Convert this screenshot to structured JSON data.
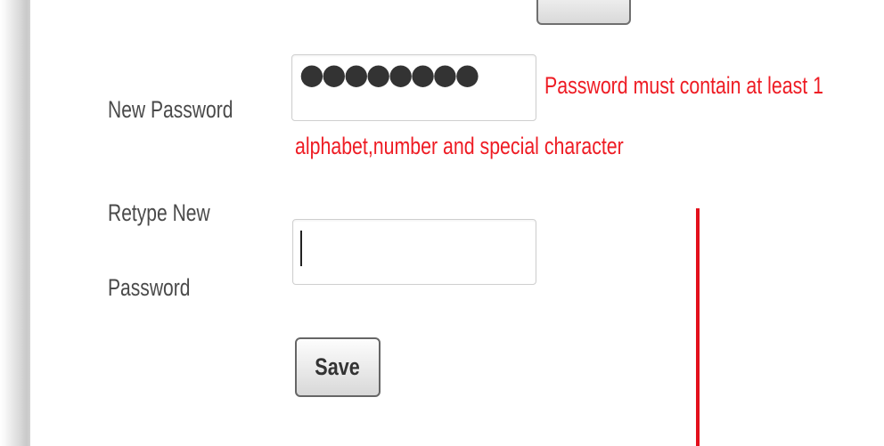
{
  "form": {
    "new_password_label": "New Password",
    "new_password_value": "●●●●●●●●",
    "error_line_1": "Password must contain at least 1",
    "error_line_2": "alphabet,number and special character",
    "retype_label_line_1": "Retype New",
    "retype_label_line_2": "Password",
    "retype_value": "",
    "save_label": "Save"
  },
  "colors": {
    "error": "#ee1c24",
    "marker": "#e3101c",
    "label": "#4a4a4a"
  }
}
